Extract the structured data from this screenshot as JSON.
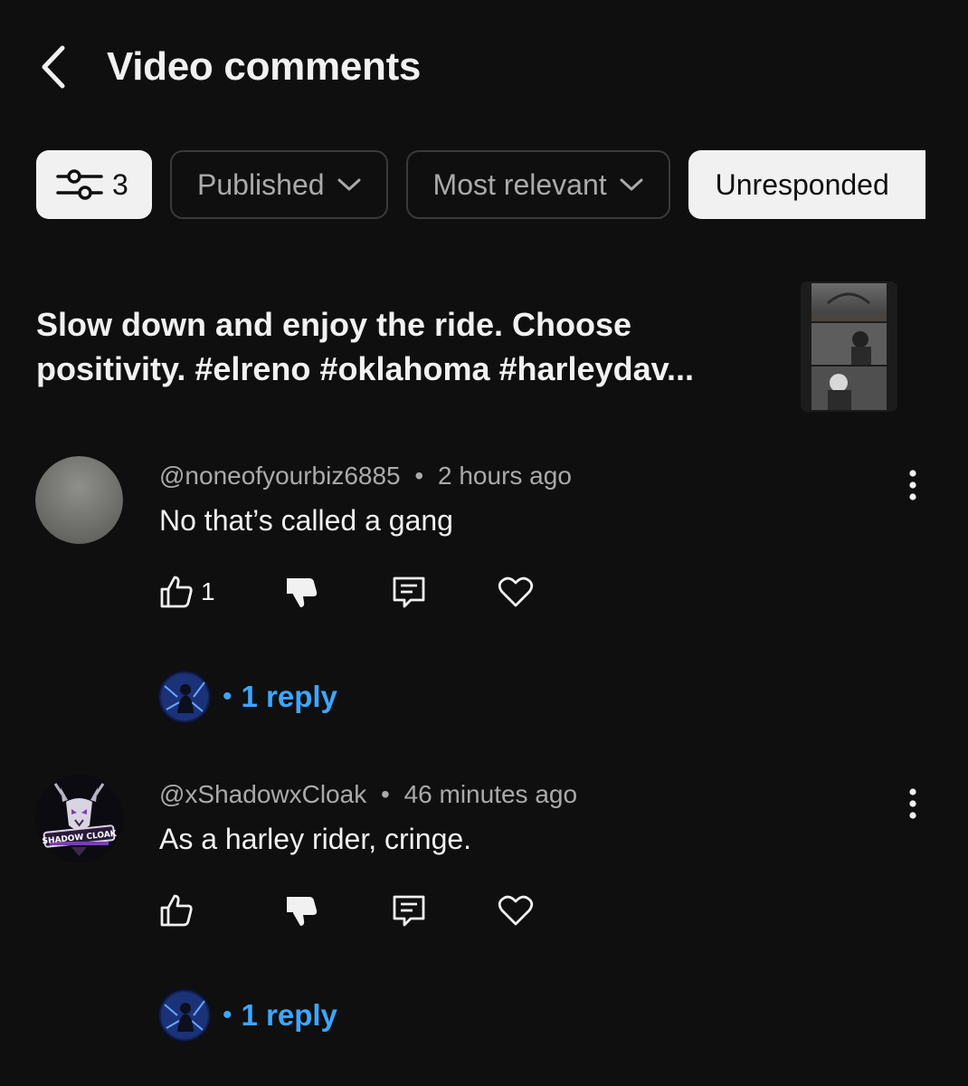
{
  "header": {
    "back_icon": "chevron-left-icon",
    "title": "Video comments"
  },
  "filters": {
    "filter_icon": "sliders-icon",
    "filter_count": "3",
    "status": "Published",
    "sort": "Most relevant",
    "response": "Unresponded"
  },
  "video": {
    "title": "Slow down and enjoy the ride. Choose positivity. #elreno #oklahoma #harleydav..."
  },
  "comments": [
    {
      "author": "@noneofyourbiz6885",
      "time": "2 hours ago",
      "text": "No that’s called a gang",
      "likes": "1",
      "reply_label": "1 reply",
      "bullet": "•"
    },
    {
      "author": "@xShadowxCloak",
      "time": "46 minutes ago",
      "text": "As a harley rider, cringe.",
      "likes": "",
      "reply_label": "1 reply",
      "bullet": "•",
      "avatar_text": "SHADOW CLOAK"
    }
  ],
  "colors": {
    "background": "#0f0f0f",
    "text": "#f1f1f1",
    "secondary_text": "#aaaaaa",
    "link": "#3ea6ff",
    "chip_active": "#f1f1f1",
    "chip_border": "#3a3a3a"
  }
}
